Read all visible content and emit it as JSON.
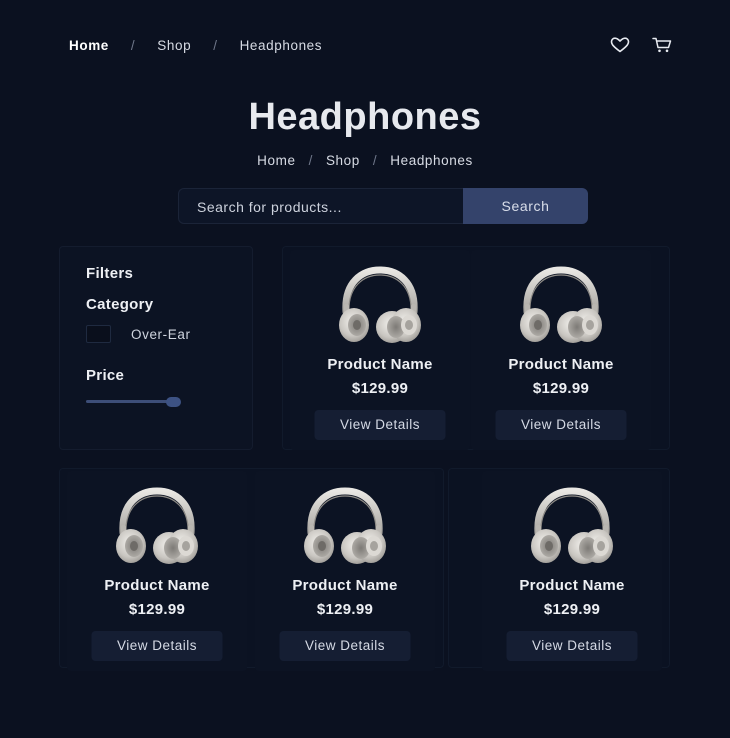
{
  "topnav": {
    "crumbs": [
      "Home",
      "Shop",
      "Headphones"
    ],
    "separator": "/",
    "icons": [
      "heart-icon",
      "cart-icon"
    ]
  },
  "hero": {
    "title": "Headphones",
    "crumbs": [
      "Home",
      "Shop",
      "Headphones"
    ],
    "separator": "/"
  },
  "search": {
    "placeholder": "Search for products...",
    "button_label": "Search"
  },
  "filters": {
    "title": "Filters",
    "category_title": "Category",
    "category_option": "Over-Ear",
    "category_checked": false,
    "price_title": "Price",
    "price_slider_value": 0.9
  },
  "products": [
    {
      "name": "Product Name",
      "price": "$129.99",
      "button": "View Details",
      "image": "headphones-image"
    },
    {
      "name": "Product Name",
      "price": "$129.99",
      "button": "View Details",
      "image": "headphones-image"
    },
    {
      "name": "Product Name",
      "price": "$129.99",
      "button": "View Details",
      "image": "headphones-image"
    },
    {
      "name": "Product Name",
      "price": "$129.99",
      "button": "View Details",
      "image": "headphones-image"
    },
    {
      "name": "Product Name",
      "price": "$129.99",
      "button": "View Details",
      "image": "headphones-image"
    }
  ],
  "colors": {
    "background": "#0b1120",
    "accent": "#34436b",
    "button_bg": "#151e33"
  }
}
